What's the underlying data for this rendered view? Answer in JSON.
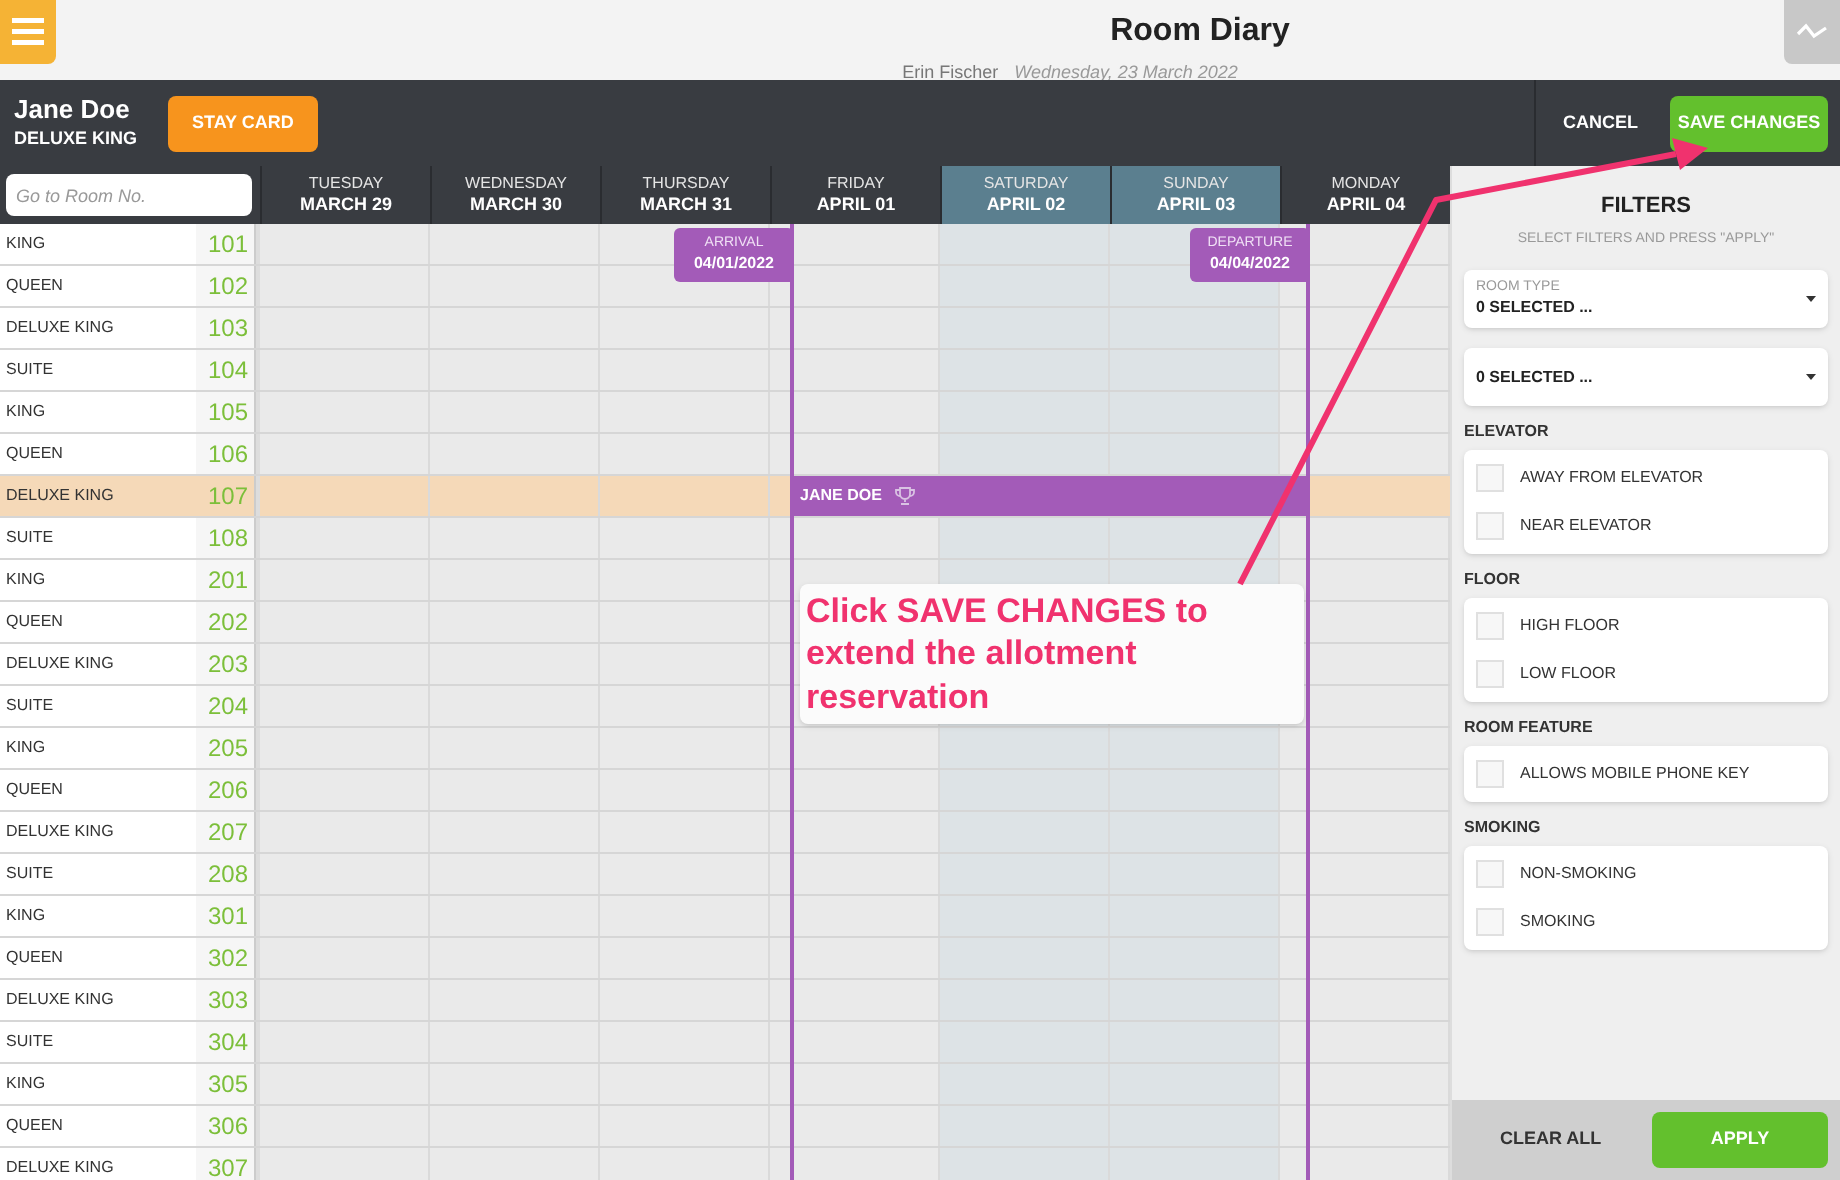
{
  "header": {
    "title": "Room Diary",
    "user": "Erin Fischer",
    "date": "Wednesday, 23 March 2022"
  },
  "guest_bar": {
    "name": "Jane Doe",
    "room_type": "DELUXE KING",
    "stay_card": "STAY CARD",
    "cancel": "CANCEL",
    "save": "SAVE CHANGES"
  },
  "search": {
    "placeholder": "Go to Room No."
  },
  "days": [
    {
      "day": "TUESDAY",
      "date": "MARCH 29",
      "weekend": false
    },
    {
      "day": "WEDNESDAY",
      "date": "MARCH 30",
      "weekend": false
    },
    {
      "day": "THURSDAY",
      "date": "MARCH 31",
      "weekend": false
    },
    {
      "day": "FRIDAY",
      "date": "APRIL 01",
      "weekend": false
    },
    {
      "day": "SATURDAY",
      "date": "APRIL 02",
      "weekend": true
    },
    {
      "day": "SUNDAY",
      "date": "APRIL 03",
      "weekend": true
    },
    {
      "day": "MONDAY",
      "date": "APRIL 04",
      "weekend": false
    }
  ],
  "markers": [
    {
      "kind": "arrival",
      "label": "ARRIVAL",
      "date": "04/01/2022"
    },
    {
      "kind": "departure",
      "label": "DEPARTURE",
      "date": "04/04/2022"
    }
  ],
  "rooms": [
    {
      "type": "KING",
      "number": "101",
      "selected": false
    },
    {
      "type": "QUEEN",
      "number": "102",
      "selected": false
    },
    {
      "type": "DELUXE KING",
      "number": "103",
      "selected": false
    },
    {
      "type": "SUITE",
      "number": "104",
      "selected": false
    },
    {
      "type": "KING",
      "number": "105",
      "selected": false
    },
    {
      "type": "QUEEN",
      "number": "106",
      "selected": false
    },
    {
      "type": "DELUXE KING",
      "number": "107",
      "selected": true,
      "booking": "JANE DOE"
    },
    {
      "type": "SUITE",
      "number": "108",
      "selected": false
    },
    {
      "type": "KING",
      "number": "201",
      "selected": false
    },
    {
      "type": "QUEEN",
      "number": "202",
      "selected": false
    },
    {
      "type": "DELUXE KING",
      "number": "203",
      "selected": false
    },
    {
      "type": "SUITE",
      "number": "204",
      "selected": false
    },
    {
      "type": "KING",
      "number": "205",
      "selected": false
    },
    {
      "type": "QUEEN",
      "number": "206",
      "selected": false
    },
    {
      "type": "DELUXE KING",
      "number": "207",
      "selected": false
    },
    {
      "type": "SUITE",
      "number": "208",
      "selected": false
    },
    {
      "type": "KING",
      "number": "301",
      "selected": false
    },
    {
      "type": "QUEEN",
      "number": "302",
      "selected": false
    },
    {
      "type": "DELUXE KING",
      "number": "303",
      "selected": false
    },
    {
      "type": "SUITE",
      "number": "304",
      "selected": false
    },
    {
      "type": "KING",
      "number": "305",
      "selected": false
    },
    {
      "type": "QUEEN",
      "number": "306",
      "selected": false
    },
    {
      "type": "DELUXE KING",
      "number": "307",
      "selected": false
    }
  ],
  "filters": {
    "title": "FILTERS",
    "subtitle": "SELECT FILTERS AND PRESS \"APPLY\"",
    "dropdowns": [
      {
        "label": "ROOM TYPE",
        "value": "0 SELECTED ..."
      },
      {
        "value": "0 SELECTED ..."
      }
    ],
    "groups": [
      {
        "title": "ELEVATOR",
        "options": [
          {
            "label": "AWAY FROM ELEVATOR",
            "checked": false
          },
          {
            "label": "NEAR ELEVATOR",
            "checked": false
          }
        ]
      },
      {
        "title": "FLOOR",
        "options": [
          {
            "label": "HIGH FLOOR",
            "checked": false
          },
          {
            "label": "LOW FLOOR",
            "checked": false
          }
        ]
      },
      {
        "title": "ROOM FEATURE",
        "options": [
          {
            "label": "ALLOWS MOBILE PHONE KEY",
            "checked": false
          }
        ]
      },
      {
        "title": "SMOKING",
        "options": [
          {
            "label": "NON-SMOKING",
            "checked": false
          },
          {
            "label": "SMOKING",
            "checked": false
          }
        ]
      }
    ],
    "clear": "CLEAR ALL",
    "apply": "APPLY"
  },
  "annotation": "Click SAVE CHANGES to extend the allotment reservation"
}
